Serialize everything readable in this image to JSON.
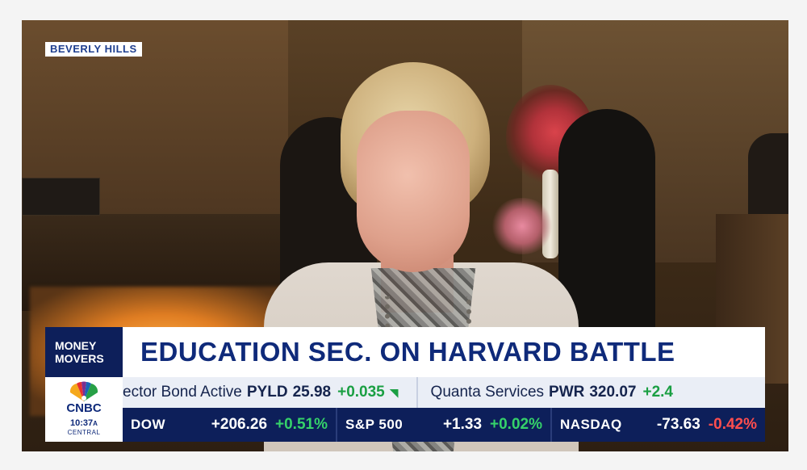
{
  "location": {
    "label": "BEVERLY HILLS"
  },
  "program": {
    "line1": "MONEY",
    "line2": "MOVERS"
  },
  "headline": {
    "text": "EDUCATION SEC. ON HARVARD BATTLE"
  },
  "network": {
    "logo_text": "CNBC",
    "time": "10:37",
    "time_suffix": "A",
    "zone": "CENTRAL",
    "icon": "peacock-icon"
  },
  "ticker": [
    {
      "name": "ector Bond Active",
      "symbol": "PYLD",
      "price": "25.98",
      "change": "+0.035",
      "arrow": "◥"
    },
    {
      "name": "Quanta Services",
      "symbol": "PWR",
      "price": "320.07",
      "change": "+2.4",
      "arrow": ""
    }
  ],
  "indices": [
    {
      "name": "DOW",
      "points": "+206.26",
      "pct": "+0.51%",
      "direction": "up"
    },
    {
      "name": "S&P 500",
      "points": "+1.33",
      "pct": "+0.02%",
      "direction": "up"
    },
    {
      "name": "NASDAQ",
      "points": "-73.63",
      "pct": "-0.42%",
      "direction": "down"
    }
  ],
  "colors": {
    "navy": "#0d1f5a",
    "headline_text": "#0f2a7a",
    "up": "#35d26a",
    "down": "#ff4e4e",
    "ticker_up": "#1a9f43"
  }
}
